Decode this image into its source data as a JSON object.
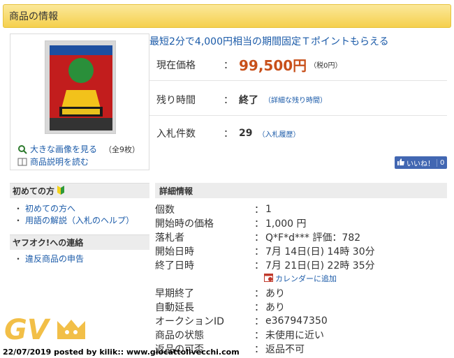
{
  "header": {
    "title": "商品の情報"
  },
  "image_panel": {
    "enlarge_link": "大きな画像を見る",
    "image_count": "（全9枚）",
    "description_link": "商品説明を読む"
  },
  "promo": "最短2分で4,000円相当の期間固定Ｔポイントもらえる",
  "price_row": {
    "label": "現在価格",
    "colon": "：",
    "price": "99,500円",
    "tax": "（税0円）"
  },
  "time_row": {
    "label": "残り時間",
    "colon": "：",
    "value": "終了",
    "link": "（詳細な残り時間）"
  },
  "bids_row": {
    "label": "入札件数",
    "colon": "：",
    "value": "29",
    "link": "（入札履歴）"
  },
  "like_button": {
    "label": "いいね！",
    "count": "0"
  },
  "sidebar": {
    "beginners": {
      "title": "初めての方",
      "links": [
        {
          "label": "初めての方へ"
        },
        {
          "label": "用語の解説（入札のヘルプ）"
        }
      ]
    },
    "contact": {
      "title": "ヤフオク!への連絡",
      "links": [
        {
          "label": "違反商品の申告"
        }
      ]
    }
  },
  "details": {
    "title": "詳細情報",
    "rows": [
      {
        "label": "個数",
        "value": "1"
      },
      {
        "label": "開始時の価格",
        "value": "1,000 円"
      },
      {
        "label": "落札者",
        "value": "Q*F*d*** 評価：782"
      },
      {
        "label": "開始日時",
        "value": "7月 14日(日) 14時 30分"
      },
      {
        "label": "終了日時",
        "value": "7月 21日(日) 22時 35分"
      },
      {
        "label": "早期終了",
        "value": "あり"
      },
      {
        "label": "自動延長",
        "value": "あり"
      },
      {
        "label": "オークションID",
        "value": "e367947350"
      },
      {
        "label": "商品の状態",
        "value": "未使用に近い"
      },
      {
        "label": "返品の可否",
        "value": "返品不可"
      }
    ],
    "colon": "：",
    "calendar_link": "カレンダーに追加"
  },
  "watermark": {
    "logo_text": "GV"
  },
  "credit": "22/07/2019 posted by kilik:: www.giocattolivecchi.com",
  "colors": {
    "accent_price": "#c8501a",
    "link": "#1a5aa8",
    "header_bg": "#f5d04d"
  }
}
